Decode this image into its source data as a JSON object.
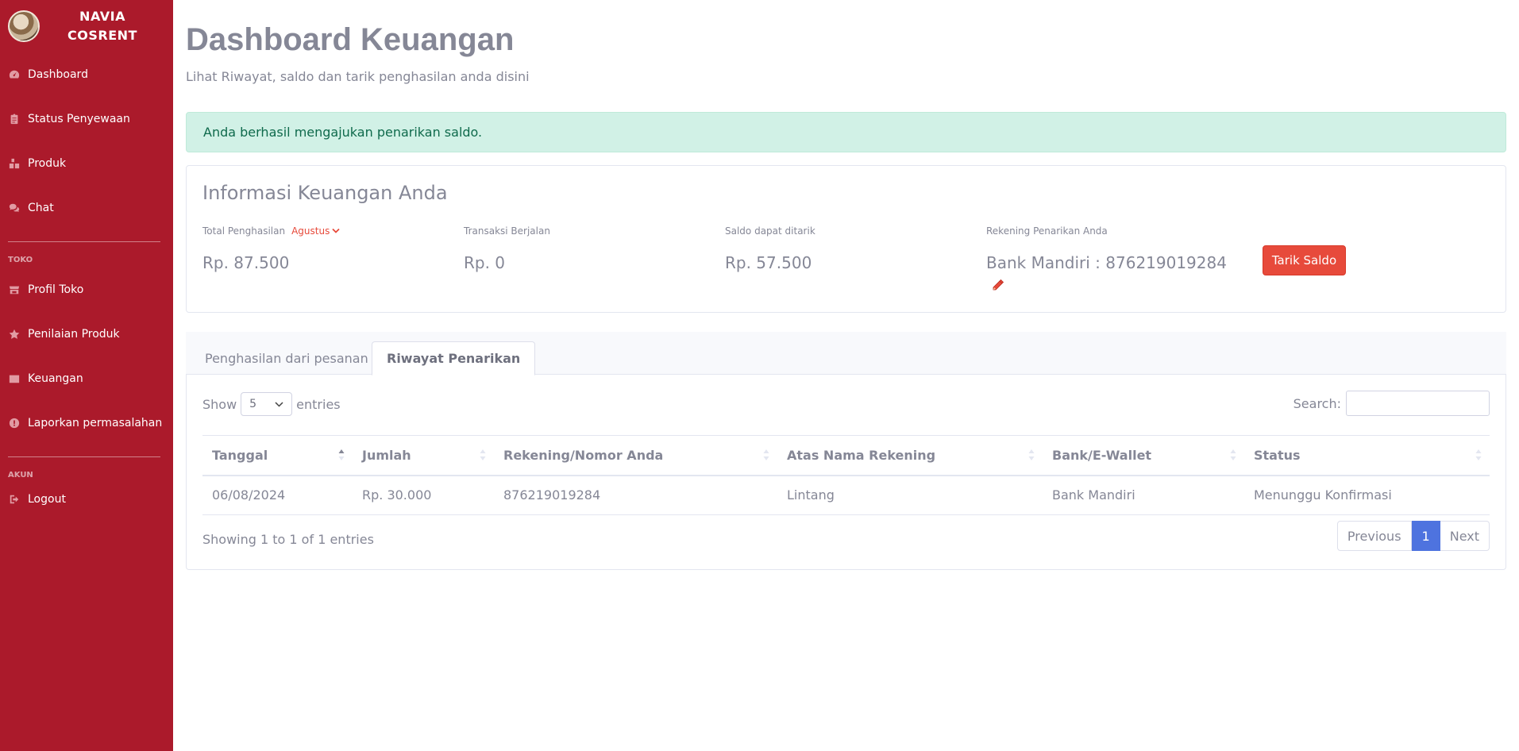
{
  "brand": {
    "line1": "NAVIA",
    "line2": "COSRENT"
  },
  "sidebar": {
    "items": [
      {
        "label": "Dashboard",
        "icon": "tachometer-icon"
      },
      {
        "label": "Status Penyewaan",
        "icon": "clipboard-icon"
      },
      {
        "label": "Produk",
        "icon": "boxes-icon"
      },
      {
        "label": "Chat",
        "icon": "comments-icon"
      }
    ],
    "toko_heading": "TOKO",
    "toko_items": [
      {
        "label": "Profil Toko",
        "icon": "store-icon"
      },
      {
        "label": "Penilaian Produk",
        "icon": "star-icon"
      },
      {
        "label": "Keuangan",
        "icon": "wallet-icon"
      },
      {
        "label": "Laporkan permasalahan",
        "icon": "exclamation-icon"
      }
    ],
    "akun_heading": "AKUN",
    "akun_items": [
      {
        "label": "Logout",
        "icon": "sign-out-icon"
      }
    ]
  },
  "header": {
    "title": "Dashboard Keuangan",
    "subtitle": "Lihat Riwayat, saldo dan tarik penghasilan anda disini"
  },
  "alert": {
    "text": "Anda berhasil mengajukan penarikan saldo."
  },
  "info": {
    "title": "Informasi Keuangan Anda",
    "total_label": "Total Penghasilan",
    "month": "Agustus",
    "total_value": "Rp. 87.500",
    "transaksi_label": "Transaksi Berjalan",
    "transaksi_value": "Rp. 0",
    "saldo_label": "Saldo dapat ditarik",
    "saldo_value": "Rp. 57.500",
    "rekening_label": "Rekening Penarikan Anda",
    "rekening_value": "Bank Mandiri : 876219019284",
    "tarik_button": "Tarik Saldo"
  },
  "tabs": [
    {
      "label": "Penghasilan dari pesanan",
      "active": false
    },
    {
      "label": "Riwayat Penarikan",
      "active": true
    }
  ],
  "table": {
    "show_label": "Show",
    "entries_value": "5",
    "entries_label": "entries",
    "search_label": "Search:",
    "columns": [
      "Tanggal",
      "Jumlah",
      "Rekening/Nomor Anda",
      "Atas Nama Rekening",
      "Bank/E-Wallet",
      "Status"
    ],
    "rows": [
      [
        "06/08/2024",
        "Rp. 30.000",
        "876219019284",
        "Lintang",
        "Bank Mandiri",
        "Menunggu Konfirmasi"
      ]
    ],
    "info": "Showing 1 to 1 of 1 entries",
    "pagination": {
      "previous": "Previous",
      "current": "1",
      "next": "Next"
    }
  },
  "colors": {
    "sidebar_bg": "#ab1a2b",
    "accent_red": "#e74a3b",
    "alert_bg": "#d1f1e6",
    "pager_active": "#4e73df"
  }
}
